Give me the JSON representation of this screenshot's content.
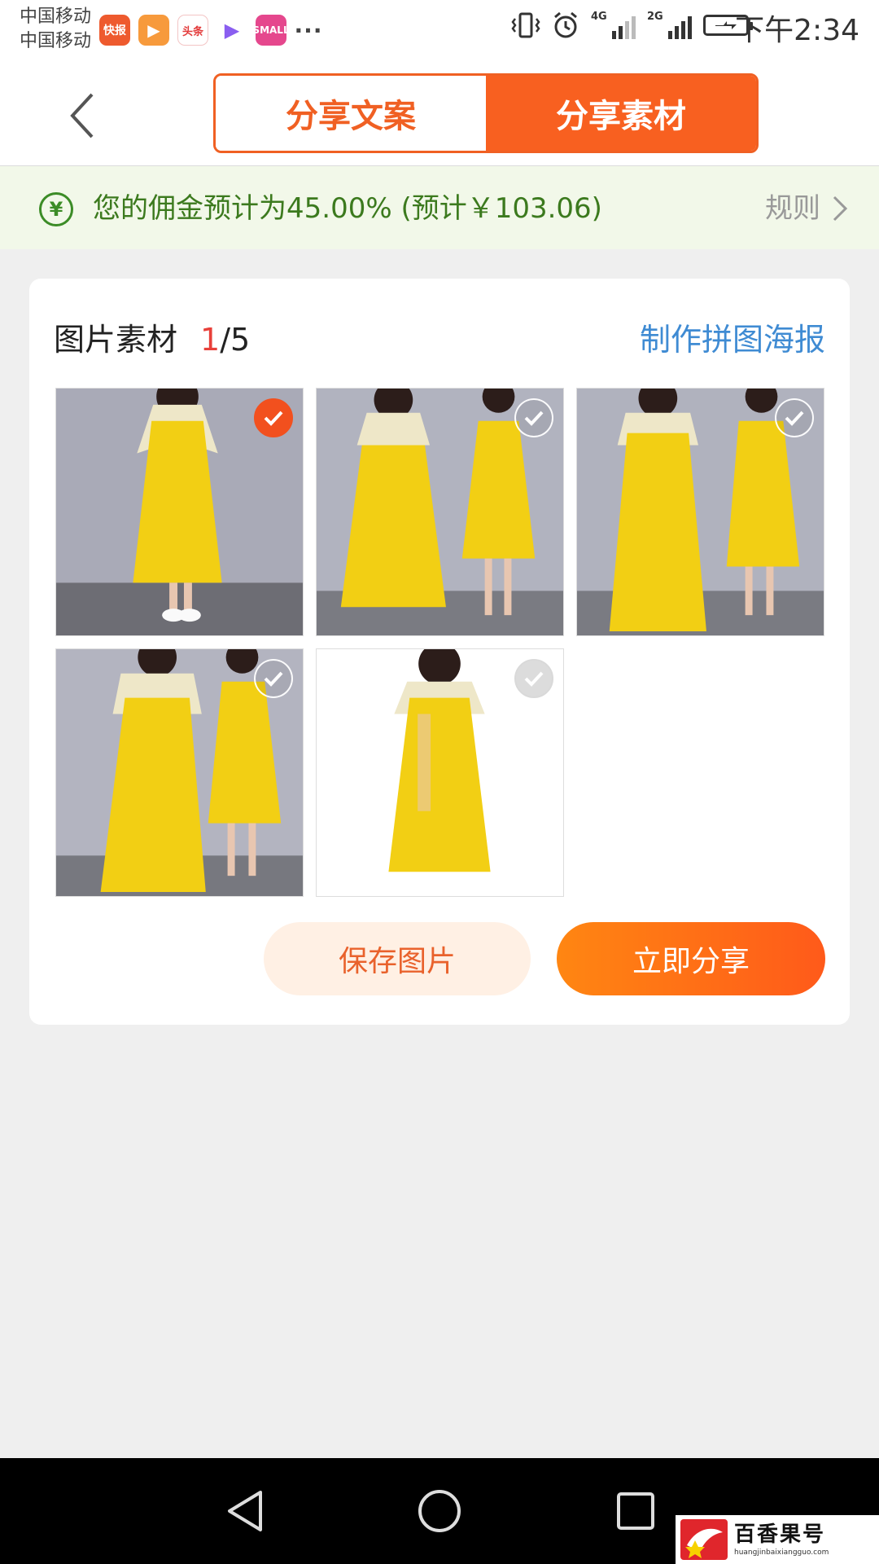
{
  "status_bar": {
    "carrier_1": "中国移动",
    "carrier_2": "中国移动",
    "apps": [
      {
        "name": "kuaibao",
        "label": "快报"
      },
      {
        "name": "video",
        "label": "▶"
      },
      {
        "name": "toutiao",
        "label": "头条"
      },
      {
        "name": "play",
        "label": "▶"
      },
      {
        "name": "shop",
        "label": "SMALL"
      }
    ],
    "more": "···",
    "signal_1": "4G",
    "signal_2": "2G",
    "time": "下午2:34"
  },
  "nav": {
    "tabs": [
      {
        "label": "分享文案",
        "active": false
      },
      {
        "label": "分享素材",
        "active": true
      }
    ]
  },
  "banner": {
    "text": "您的佣金预计为45.00% (预计￥103.06)",
    "rules_label": "规则"
  },
  "card": {
    "title": "图片素材",
    "index_current": "1",
    "index_total": "/5",
    "poster_link": "制作拼图海报",
    "images": [
      {
        "alt": "yellow dress photo 1",
        "selected": true
      },
      {
        "alt": "yellow dress photo 2",
        "selected": false
      },
      {
        "alt": "yellow dress photo 3",
        "selected": false
      },
      {
        "alt": "yellow dress photo 4",
        "selected": false
      },
      {
        "alt": "yellow dress photo 5",
        "selected": false
      }
    ],
    "save_button": "保存图片",
    "share_button": "立即分享"
  },
  "watermark": {
    "main": "百香果号",
    "sub": "huangjinbaixiangguo.com"
  },
  "colors": {
    "accent": "#f86020",
    "commission_green": "#3c7a1e",
    "link_blue": "#3f8bd3",
    "counter_red": "#e8403a"
  }
}
